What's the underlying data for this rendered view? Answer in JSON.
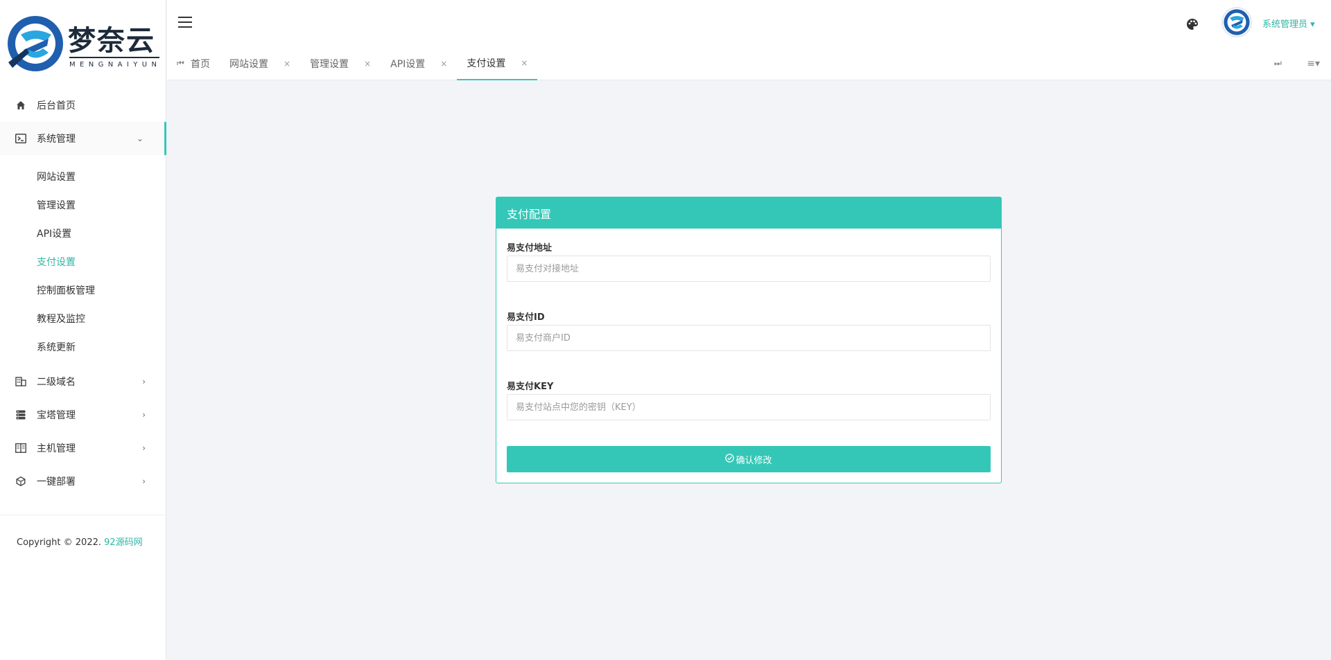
{
  "brand": {
    "name": "梦奈云",
    "subtitle": "MENGNAIYUN"
  },
  "sidebar": {
    "items": [
      {
        "label": "后台首页",
        "icon": "home-icon"
      },
      {
        "label": "系统管理",
        "icon": "terminal-icon",
        "open": true,
        "children": [
          {
            "label": "网站设置"
          },
          {
            "label": "管理设置"
          },
          {
            "label": "API设置"
          },
          {
            "label": "支付设置",
            "active": true
          },
          {
            "label": "控制面板管理"
          },
          {
            "label": "教程及监控"
          },
          {
            "label": "系统更新"
          }
        ]
      },
      {
        "label": "二级域名",
        "icon": "building-icon"
      },
      {
        "label": "宝塔管理",
        "icon": "server-icon"
      },
      {
        "label": "主机管理",
        "icon": "panel-icon"
      },
      {
        "label": "一键部署",
        "icon": "cube-icon"
      }
    ],
    "copyright_prefix": "Copyright © 2022.",
    "copyright_link": "92源码网"
  },
  "topbar": {
    "user_name": "系统管理员"
  },
  "tabs": [
    {
      "label": "首页",
      "closable": false
    },
    {
      "label": "网站设置",
      "closable": true
    },
    {
      "label": "管理设置",
      "closable": true
    },
    {
      "label": "API设置",
      "closable": true
    },
    {
      "label": "支付设置",
      "closable": true,
      "active": true
    }
  ],
  "card": {
    "title": "支付配置",
    "fields": [
      {
        "label": "易支付地址",
        "placeholder": "易支付对接地址",
        "value": ""
      },
      {
        "label": "易支付ID",
        "placeholder": "易支付商户ID",
        "value": ""
      },
      {
        "label": "易支付KEY",
        "placeholder": "易支付站点中您的密钥（KEY）",
        "value": ""
      }
    ],
    "submit_label": "确认修改"
  },
  "colors": {
    "accent": "#34c7b7",
    "accent_text": "#2fb6a6"
  }
}
